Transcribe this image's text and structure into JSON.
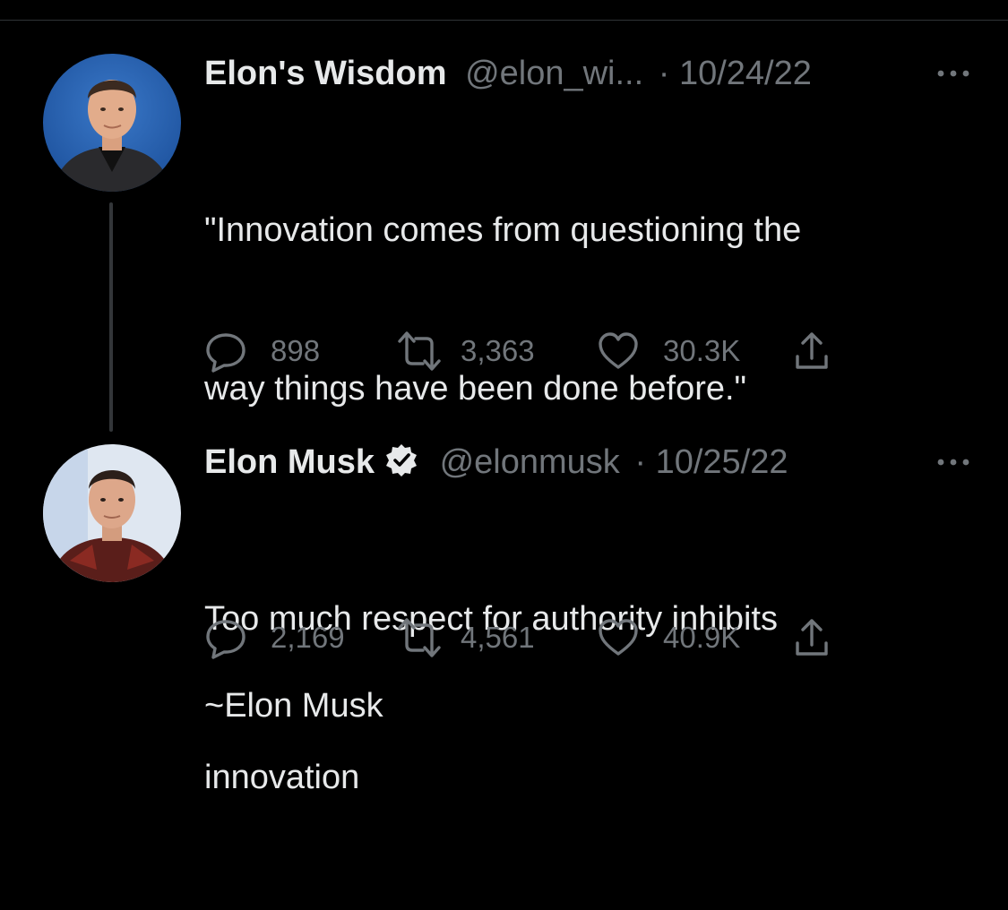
{
  "tweets": [
    {
      "display_name": "Elon's Wisdom",
      "handle": "@elon_wi...",
      "separator": "·",
      "date": "10/24/22",
      "verified": false,
      "text_lines": [
        "\"Innovation comes from questioning the",
        "way things have been done before.\"",
        "",
        "~Elon Musk"
      ],
      "reply_count": "898",
      "retweet_count": "3,363",
      "like_count": "30.3K"
    },
    {
      "display_name": "Elon Musk",
      "handle": "@elonmusk",
      "separator": "·",
      "date": "10/25/22",
      "verified": true,
      "text_lines": [
        "Too much respect for authority inhibits",
        "innovation"
      ],
      "reply_count": "2,169",
      "retweet_count": "4,561",
      "like_count": "40.9K"
    }
  ],
  "icons": {
    "more": "more-dots-icon",
    "reply": "reply-bubble-icon",
    "retweet": "retweet-icon",
    "like": "heart-icon",
    "share": "share-icon",
    "verified": "verified-badge-icon"
  },
  "colors": {
    "background": "#000000",
    "text_primary": "#e7e9ea",
    "text_secondary": "#71767b",
    "divider": "#2f3336",
    "thread_line": "#333639"
  }
}
